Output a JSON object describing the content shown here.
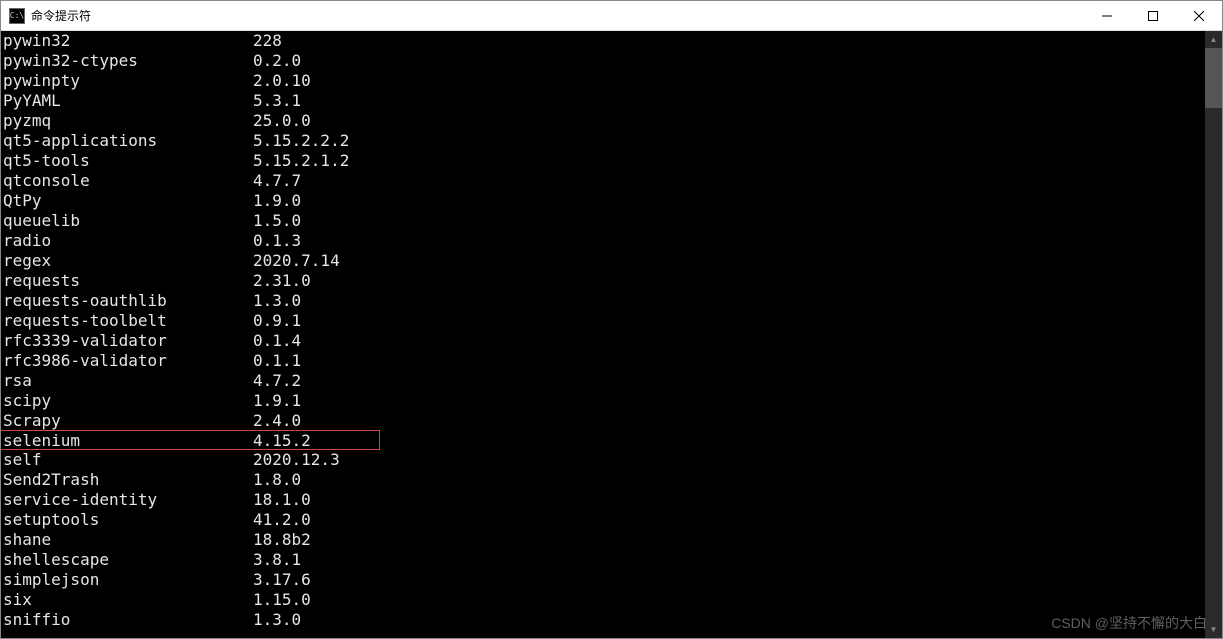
{
  "window": {
    "title": "命令提示符",
    "icon_label": "C:\\"
  },
  "packages": [
    {
      "name": "pywin32",
      "version": "228",
      "highlight": false
    },
    {
      "name": "pywin32-ctypes",
      "version": "0.2.0",
      "highlight": false
    },
    {
      "name": "pywinpty",
      "version": "2.0.10",
      "highlight": false
    },
    {
      "name": "PyYAML",
      "version": "5.3.1",
      "highlight": false
    },
    {
      "name": "pyzmq",
      "version": "25.0.0",
      "highlight": false
    },
    {
      "name": "qt5-applications",
      "version": "5.15.2.2.2",
      "highlight": false
    },
    {
      "name": "qt5-tools",
      "version": "5.15.2.1.2",
      "highlight": false
    },
    {
      "name": "qtconsole",
      "version": "4.7.7",
      "highlight": false
    },
    {
      "name": "QtPy",
      "version": "1.9.0",
      "highlight": false
    },
    {
      "name": "queuelib",
      "version": "1.5.0",
      "highlight": false
    },
    {
      "name": "radio",
      "version": "0.1.3",
      "highlight": false
    },
    {
      "name": "regex",
      "version": "2020.7.14",
      "highlight": false
    },
    {
      "name": "requests",
      "version": "2.31.0",
      "highlight": false
    },
    {
      "name": "requests-oauthlib",
      "version": "1.3.0",
      "highlight": false
    },
    {
      "name": "requests-toolbelt",
      "version": "0.9.1",
      "highlight": false
    },
    {
      "name": "rfc3339-validator",
      "version": "0.1.4",
      "highlight": false
    },
    {
      "name": "rfc3986-validator",
      "version": "0.1.1",
      "highlight": false
    },
    {
      "name": "rsa",
      "version": "4.7.2",
      "highlight": false
    },
    {
      "name": "scipy",
      "version": "1.9.1",
      "highlight": false
    },
    {
      "name": "Scrapy",
      "version": "2.4.0",
      "highlight": false
    },
    {
      "name": "selenium",
      "version": "4.15.2",
      "highlight": true
    },
    {
      "name": "self",
      "version": "2020.12.3",
      "highlight": false
    },
    {
      "name": "Send2Trash",
      "version": "1.8.0",
      "highlight": false
    },
    {
      "name": "service-identity",
      "version": "18.1.0",
      "highlight": false
    },
    {
      "name": "setuptools",
      "version": "41.2.0",
      "highlight": false
    },
    {
      "name": "shane",
      "version": "18.8b2",
      "highlight": false
    },
    {
      "name": "shellescape",
      "version": "3.8.1",
      "highlight": false
    },
    {
      "name": "simplejson",
      "version": "3.17.6",
      "highlight": false
    },
    {
      "name": "six",
      "version": "1.15.0",
      "highlight": false
    },
    {
      "name": "sniffio",
      "version": "1.3.0",
      "highlight": false
    }
  ],
  "watermark": "CSDN @坚持不懈的大白"
}
